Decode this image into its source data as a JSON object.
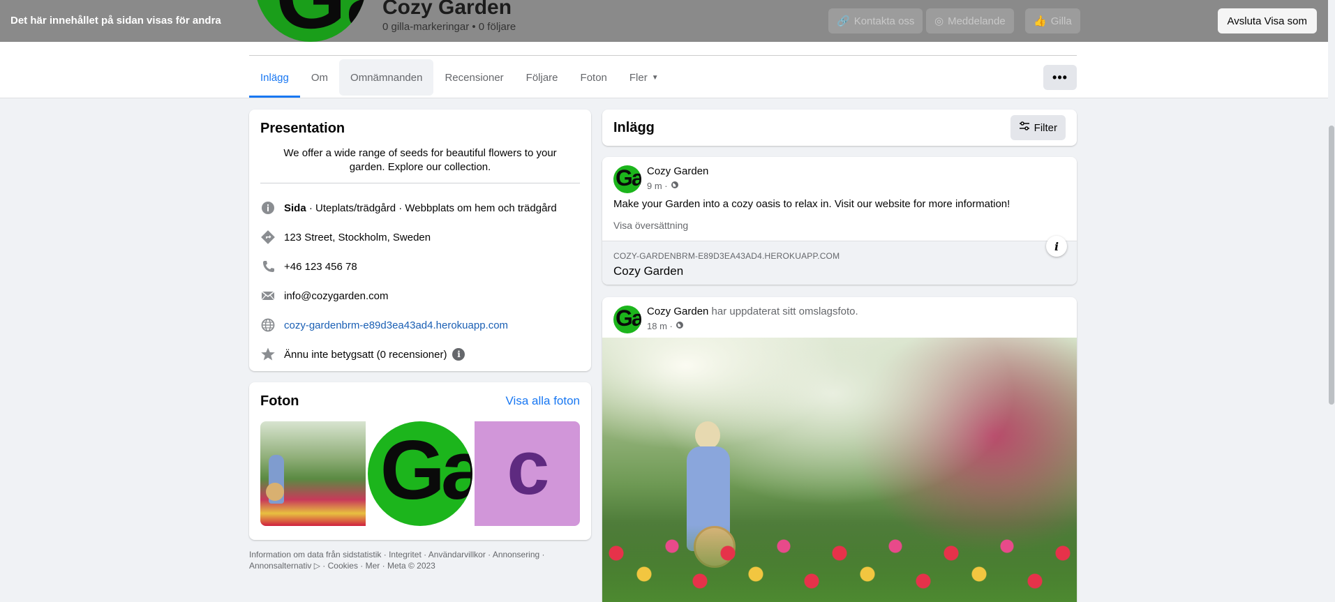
{
  "banner": {
    "notice": "Det här innehållet på sidan visas för andra",
    "page_name": "Cozy Garden",
    "stats": "0 gilla-markeringar • 0 följare",
    "contact_label": "Kontakta oss",
    "message_label": "Meddelande",
    "like_label": "Gilla",
    "exit_label": "Avsluta Visa som",
    "avatar_letters": "Ga"
  },
  "tabs": [
    {
      "label": "Inlägg"
    },
    {
      "label": "Om"
    },
    {
      "label": "Omnämnanden"
    },
    {
      "label": "Recensioner"
    },
    {
      "label": "Följare"
    },
    {
      "label": "Foton"
    },
    {
      "label": "Fler"
    }
  ],
  "more_label": "•••",
  "intro": {
    "title": "Presentation",
    "description": "We offer a wide range of seeds for beautiful flowers to your garden. Explore our collection.",
    "category_bold": "Sida",
    "category_rest": " · Uteplats/trädgård · Webbplats om hem och trädgård",
    "address": "123 Street, Stockholm, Sweden",
    "phone": "+46 123 456 78",
    "email": "info@cozygarden.com",
    "website": "cozy-gardenbrm-e89d3ea43ad4.herokuapp.com",
    "rating": "Ännu inte betygsatt (0 recensioner)",
    "rating_info": "i"
  },
  "photos": {
    "title": "Foton",
    "see_all": "Visa alla foton",
    "logo_letters": "Ga",
    "letter_tile": "c"
  },
  "footer": {
    "links": "Information om data från sidstatistik · Integritet · Användarvillkor · Annonsering · Annonsalternativ ▷ · Cookies · Mer · Meta © 2023"
  },
  "posts": {
    "title": "Inlägg",
    "filter_label": "Filter",
    "items": [
      {
        "author": "Cozy Garden",
        "action": "",
        "time": "9 m ·",
        "text": "Make your Garden into a cozy oasis to relax in. Visit our website for more information!",
        "translate": "Visa översättning",
        "link_domain": "COZY-GARDENBRM-E89D3EA43AD4.HEROKUAPP.COM",
        "link_title": "Cozy Garden",
        "info": "i"
      },
      {
        "author": "Cozy Garden",
        "action": " har uppdaterat sitt omslagsfoto.",
        "time": "18 m ·"
      }
    ]
  },
  "colors": {
    "accent": "#1877f2",
    "banner_gray": "#8a8a8a",
    "logo_green": "#1cb51c",
    "tile_purple": "#d196d9"
  }
}
